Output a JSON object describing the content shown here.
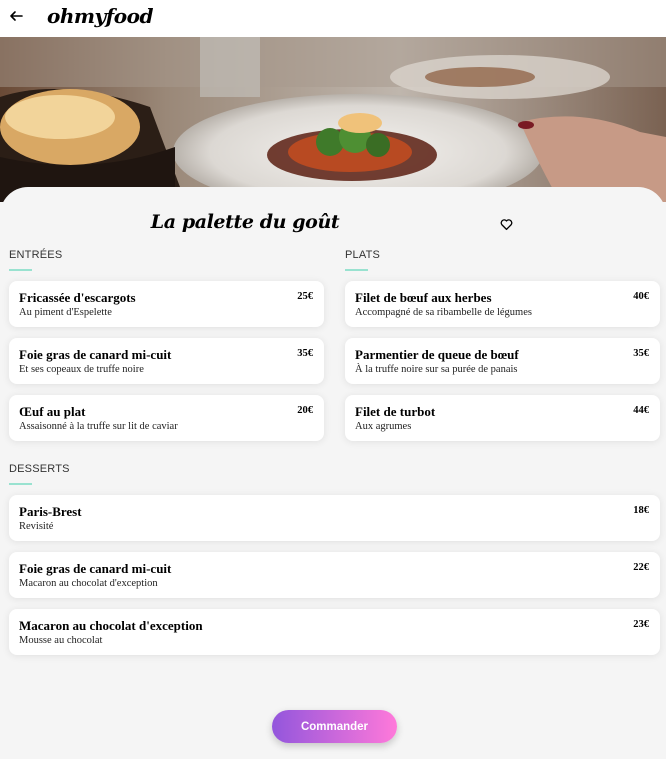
{
  "header": {
    "brand": "ohmyfood",
    "back_icon": "arrow-left-icon"
  },
  "restaurant": {
    "name": "La palette du goût",
    "favorite_icon": "heart-outline-icon"
  },
  "sections": {
    "entrees": {
      "title": "ENTRÉES",
      "items": [
        {
          "name": "Fricassée d'escargots",
          "desc": "Au piment d'Espelette",
          "price": "25€"
        },
        {
          "name": "Foie gras de canard mi-cuit",
          "desc": "Et ses copeaux de truffe noire",
          "price": "35€"
        },
        {
          "name": "Œuf au plat",
          "desc": "Assaisonné à la truffe sur lit de caviar",
          "price": "20€"
        }
      ]
    },
    "plats": {
      "title": "PLATS",
      "items": [
        {
          "name": "Filet de bœuf aux herbes",
          "desc": "Accompagné de sa ribambelle de légumes",
          "price": "40€"
        },
        {
          "name": "Parmentier de queue de bœuf",
          "desc": "À la truffe noire sur sa purée de panais",
          "price": "35€"
        },
        {
          "name": "Filet de turbot",
          "desc": "Aux agrumes",
          "price": "44€"
        }
      ]
    },
    "desserts": {
      "title": "DESSERTS",
      "items": [
        {
          "name": "Paris-Brest",
          "desc": "Revisité",
          "price": "18€"
        },
        {
          "name": "Foie gras de canard mi-cuit",
          "desc": "Macaron au chocolat d'exception",
          "price": "22€"
        },
        {
          "name": "Macaron au chocolat d'exception",
          "desc": "Mousse au chocolat",
          "price": "23€"
        }
      ]
    }
  },
  "order_button": {
    "label": "Commander"
  },
  "colors": {
    "accent_line": "#99e2d0",
    "button_gradient_start": "#9356dc",
    "button_gradient_end": "#ff79da"
  }
}
